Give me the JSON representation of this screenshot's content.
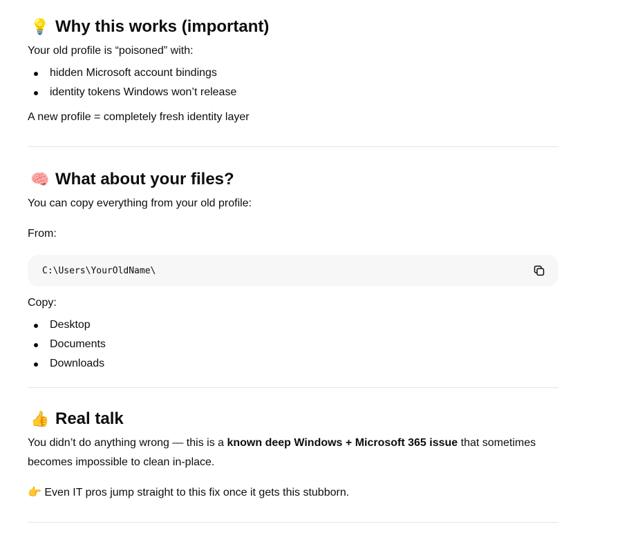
{
  "section1": {
    "icon": "💡",
    "icon_name": "lightbulb-icon",
    "title": "Why this works (important)",
    "intro": "Your old profile is “poisoned” with:",
    "bullets": [
      "hidden Microsoft account bindings",
      "identity tokens Windows won’t release"
    ],
    "conclusion": "A new profile = completely fresh identity layer"
  },
  "section2": {
    "icon": "🧠",
    "icon_name": "brain-icon",
    "title": "What about your files?",
    "intro": "You can copy everything from your old profile:",
    "from_label": "From:",
    "code": "C:\\Users\\YourOldName\\",
    "copy_icon_name": "copy-icon",
    "copy_label": "Copy:",
    "bullets": [
      "Desktop",
      "Documents",
      "Downloads"
    ]
  },
  "section3": {
    "icon": "👍",
    "icon_name": "thumbs-up-icon",
    "title": "Real talk",
    "para_before": "You didn’t do anything wrong — this is a ",
    "para_bold": "known deep Windows + Microsoft 365 issue",
    "para_after": " that sometimes becomes impossible to clean in-place.",
    "tip_icon": "👉",
    "tip_icon_name": "pointing-right-icon",
    "tip_text": " Even IT pros jump straight to this fix once it gets this stubborn."
  }
}
